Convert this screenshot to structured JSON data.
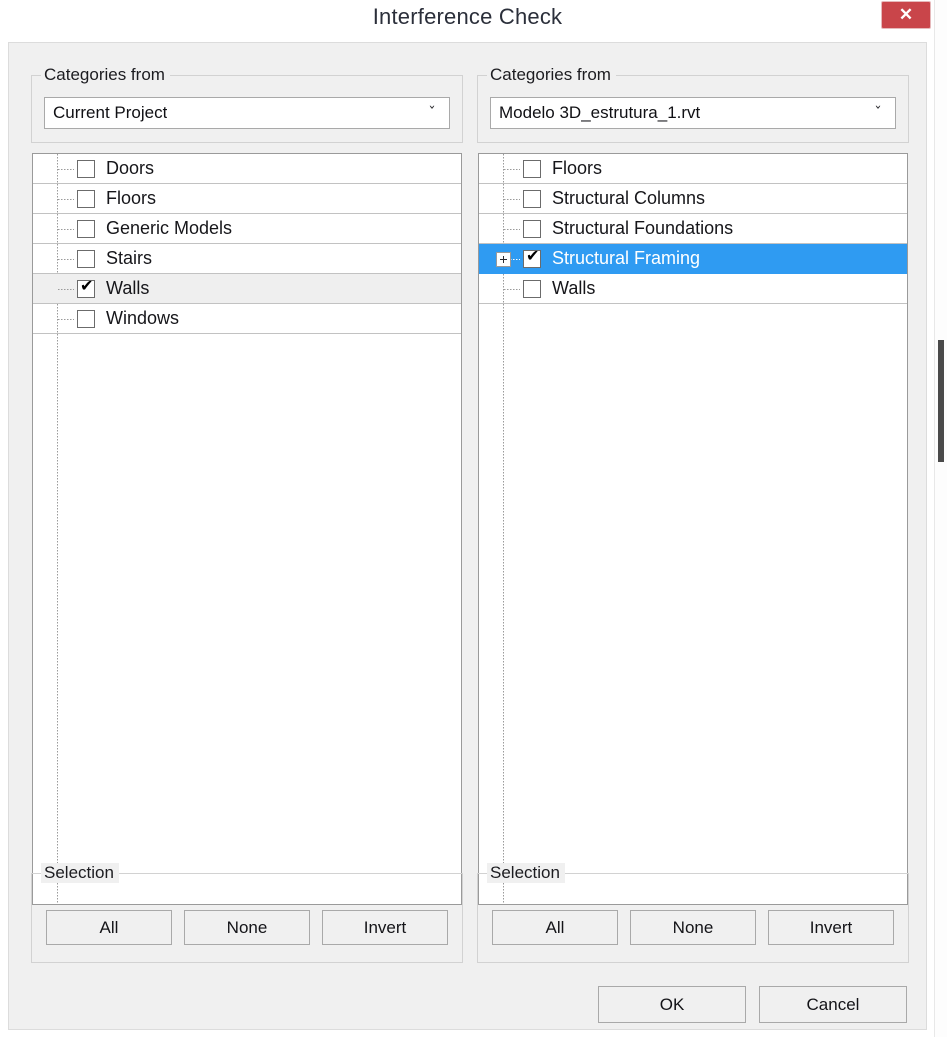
{
  "window": {
    "title": "Interference Check",
    "close_label": "✕",
    "close_icon": "close-icon",
    "accent_selection": "#2f9bf2",
    "close_button_color": "#c9454a"
  },
  "left_panel": {
    "group_label": "Categories from",
    "combo": {
      "value": "Current Project",
      "arrow": "ˇ",
      "arrow_icon": "chevron-down-icon"
    },
    "rows": [
      {
        "label": "Doors",
        "checked": false,
        "selected": false,
        "expandable": false
      },
      {
        "label": "Floors",
        "checked": false,
        "selected": false,
        "expandable": false
      },
      {
        "label": "Generic Models",
        "checked": false,
        "selected": false,
        "expandable": false
      },
      {
        "label": "Stairs",
        "checked": false,
        "selected": false,
        "expandable": false
      },
      {
        "label": "Walls",
        "checked": true,
        "selected": false,
        "expandable": false
      },
      {
        "label": "Windows",
        "checked": false,
        "selected": false,
        "expandable": false
      }
    ],
    "selection": {
      "group_label": "Selection",
      "all": "All",
      "none": "None",
      "invert": "Invert"
    }
  },
  "right_panel": {
    "group_label": "Categories from",
    "combo": {
      "value": "Modelo 3D_estrutura_1.rvt",
      "arrow": "ˇ",
      "arrow_icon": "chevron-down-icon"
    },
    "rows": [
      {
        "label": "Floors",
        "checked": false,
        "selected": false,
        "expandable": false
      },
      {
        "label": "Structural Columns",
        "checked": false,
        "selected": false,
        "expandable": false
      },
      {
        "label": "Structural Foundations",
        "checked": false,
        "selected": false,
        "expandable": false
      },
      {
        "label": "Structural Framing",
        "checked": true,
        "selected": true,
        "expandable": true
      },
      {
        "label": "Walls",
        "checked": false,
        "selected": false,
        "expandable": false
      }
    ],
    "selection": {
      "group_label": "Selection",
      "all": "All",
      "none": "None",
      "invert": "Invert"
    }
  },
  "footer": {
    "ok": "OK",
    "cancel": "Cancel"
  },
  "checkmark_glyph": "✔"
}
